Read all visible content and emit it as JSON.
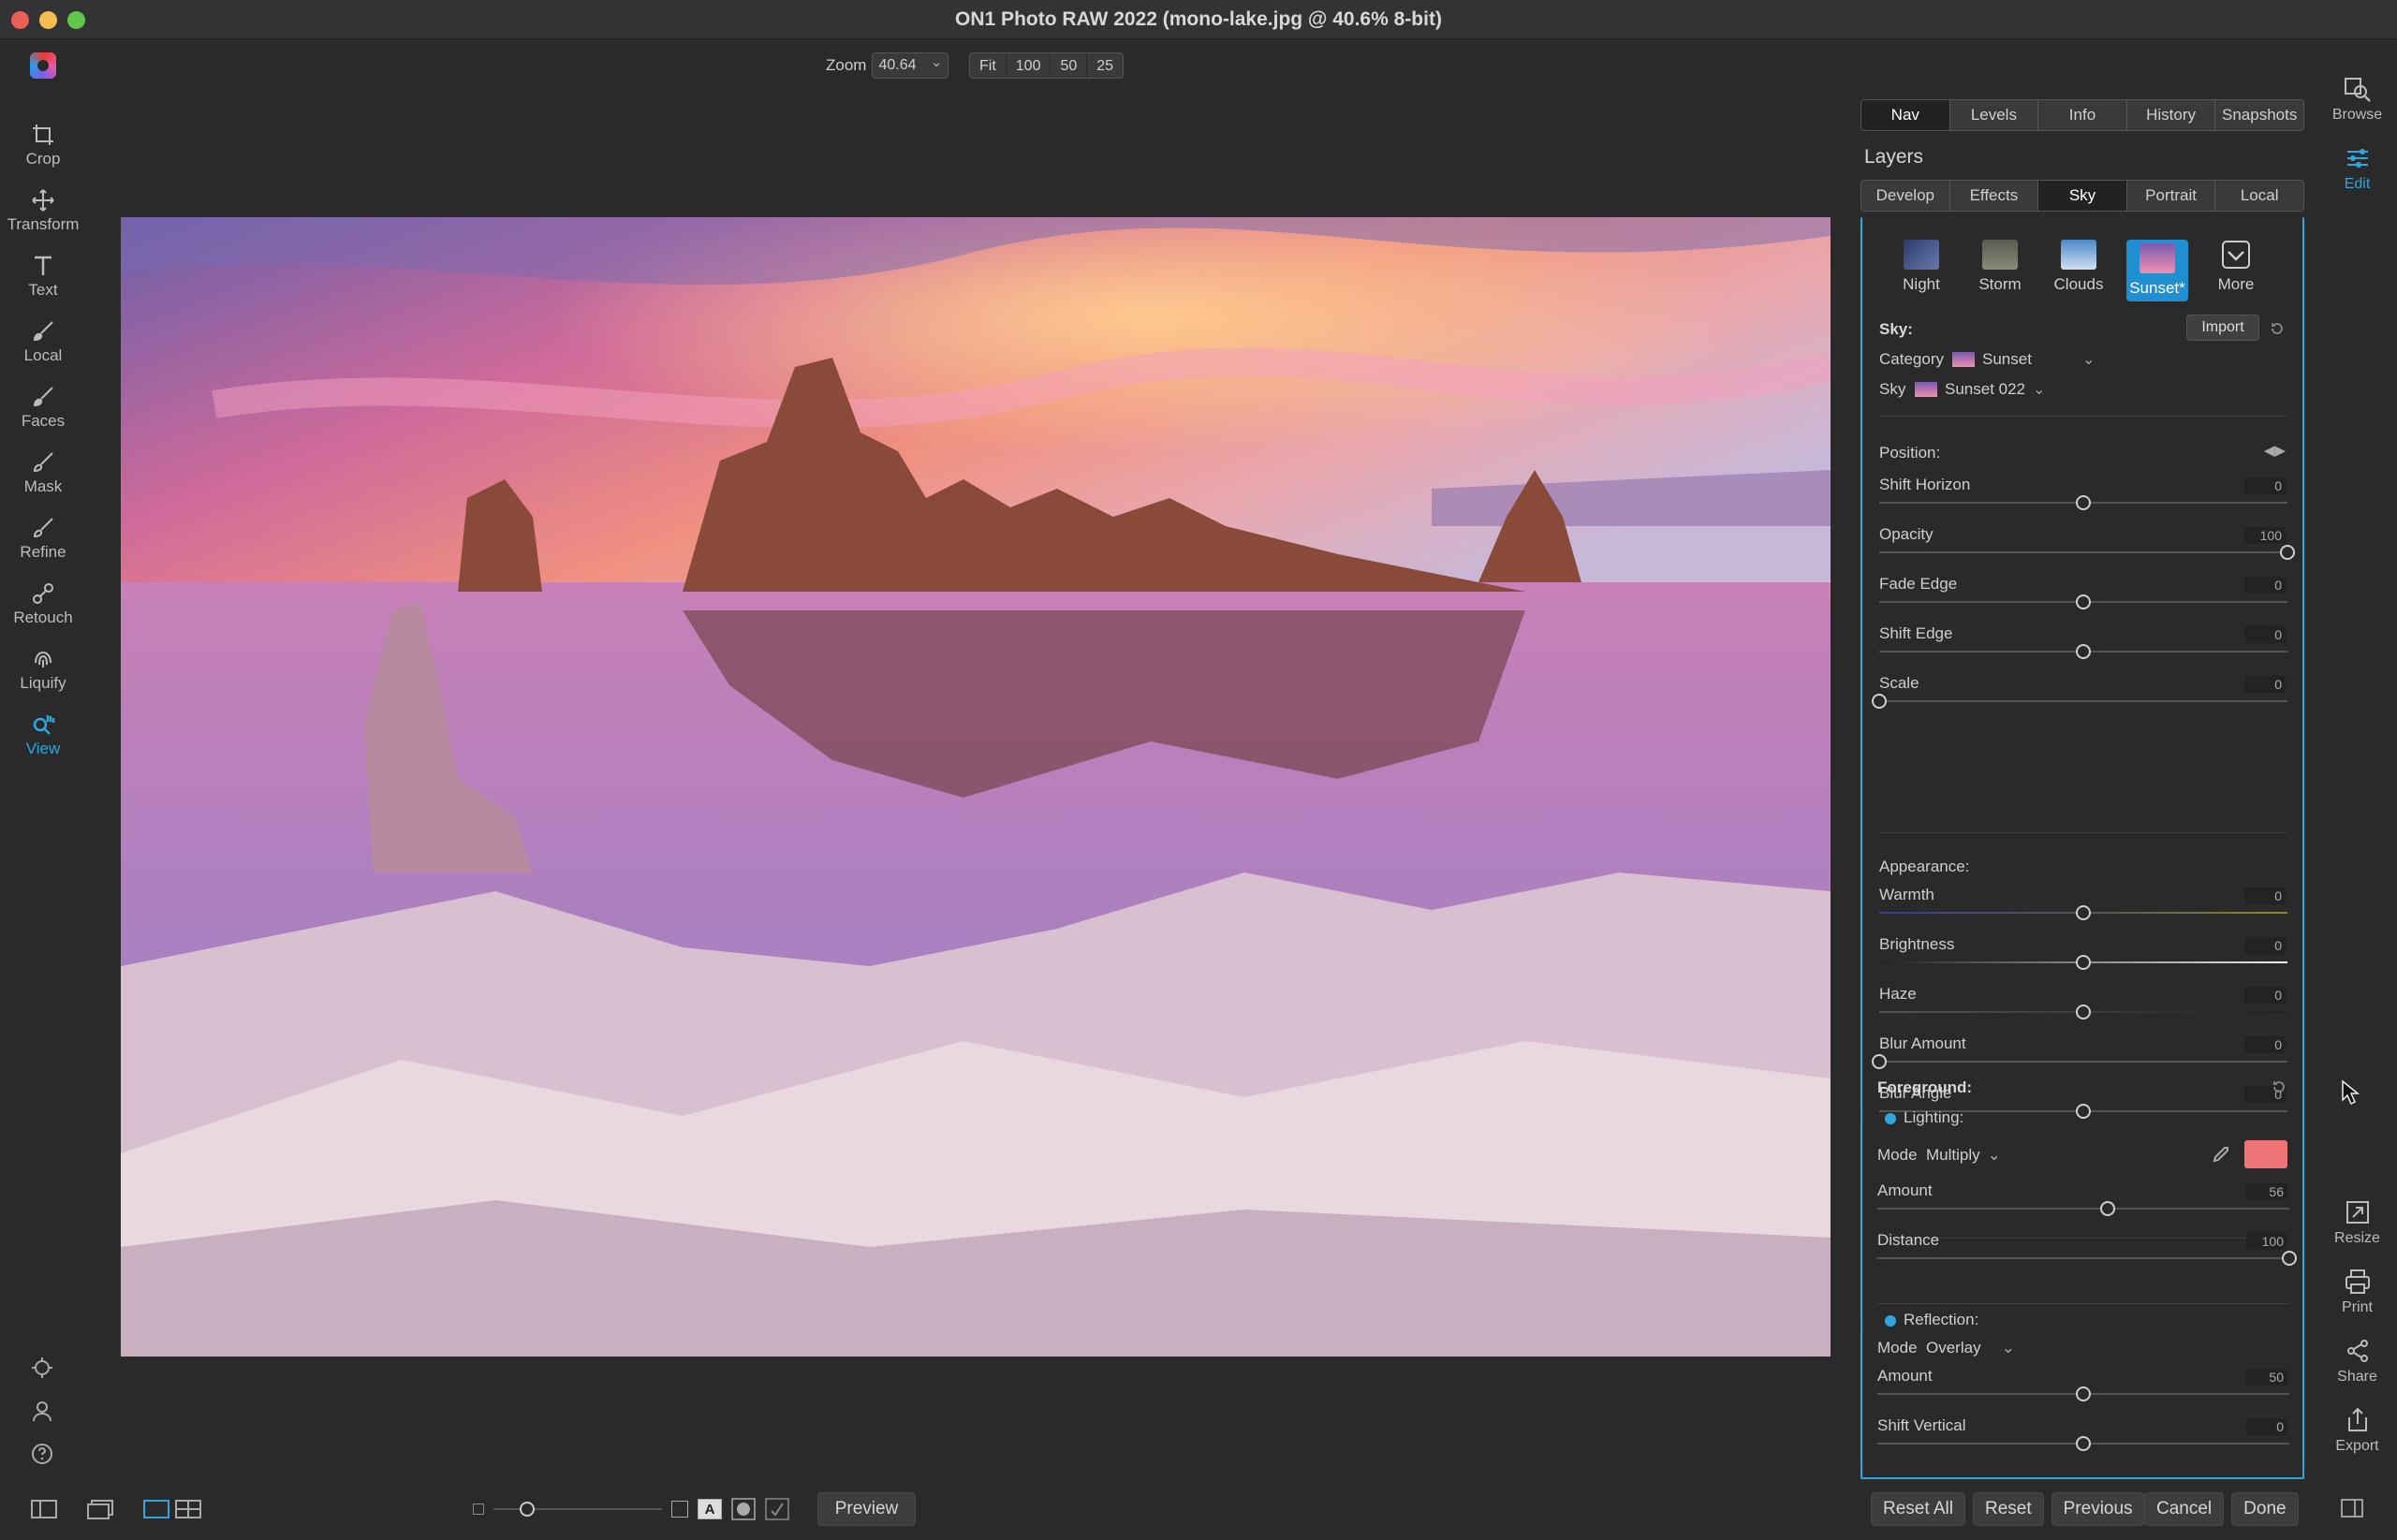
{
  "window": {
    "title": "ON1 Photo RAW 2022 (mono-lake.jpg @ 40.6% 8-bit)"
  },
  "zoom": {
    "label": "Zoom",
    "value": "40.64",
    "presets": [
      "Fit",
      "100",
      "50",
      "25"
    ]
  },
  "left_tools": [
    {
      "name": "crop",
      "label": "Crop"
    },
    {
      "name": "transform",
      "label": "Transform"
    },
    {
      "name": "text",
      "label": "Text"
    },
    {
      "name": "local",
      "label": "Local"
    },
    {
      "name": "faces",
      "label": "Faces"
    },
    {
      "name": "mask",
      "label": "Mask"
    },
    {
      "name": "refine",
      "label": "Refine"
    },
    {
      "name": "retouch",
      "label": "Retouch"
    },
    {
      "name": "liquify",
      "label": "Liquify"
    },
    {
      "name": "view",
      "label": "View",
      "active": true
    }
  ],
  "right_rail": {
    "top": [
      {
        "name": "browse",
        "label": "Browse"
      },
      {
        "name": "edit",
        "label": "Edit",
        "active": true
      }
    ],
    "bottom": [
      {
        "name": "resize",
        "label": "Resize"
      },
      {
        "name": "print",
        "label": "Print"
      },
      {
        "name": "share",
        "label": "Share"
      },
      {
        "name": "export",
        "label": "Export"
      }
    ]
  },
  "panel_tabs": [
    "Nav",
    "Levels",
    "Info",
    "History",
    "Snapshots"
  ],
  "panel_tabs_selected": "Nav",
  "layers_title": "Layers",
  "module_tabs": [
    "Develop",
    "Effects",
    "Sky",
    "Portrait",
    "Local"
  ],
  "module_tabs_selected": "Sky",
  "sky_presets": [
    {
      "label": "Night"
    },
    {
      "label": "Storm"
    },
    {
      "label": "Clouds"
    },
    {
      "label": "Sunset*",
      "selected": true
    },
    {
      "label": "More"
    }
  ],
  "sky": {
    "header": "Sky:",
    "import_label": "Import",
    "category_label": "Category",
    "category_value": "Sunset",
    "sky_label": "Sky",
    "sky_value": "Sunset 022"
  },
  "position": {
    "header": "Position:",
    "sliders": [
      {
        "label": "Shift Horizon",
        "value": "0",
        "pct": 0.5
      },
      {
        "label": "Opacity",
        "value": "100",
        "pct": 1.0
      },
      {
        "label": "Fade Edge",
        "value": "0",
        "pct": 0.5
      },
      {
        "label": "Shift Edge",
        "value": "0",
        "pct": 0.5
      },
      {
        "label": "Scale",
        "value": "0",
        "pct": 0.0
      }
    ]
  },
  "appearance": {
    "header": "Appearance:",
    "sliders": [
      {
        "label": "Warmth",
        "value": "0",
        "pct": 0.5
      },
      {
        "label": "Brightness",
        "value": "0",
        "pct": 0.5
      },
      {
        "label": "Haze",
        "value": "0",
        "pct": 0.5
      },
      {
        "label": "Blur Amount",
        "value": "0",
        "pct": 0.0
      },
      {
        "label": "Blur Angle",
        "value": "0",
        "pct": 0.5
      }
    ]
  },
  "foreground": {
    "header": "Foreground:",
    "lighting_label": "Lighting:",
    "mode_label": "Mode",
    "mode_value": "Multiply",
    "color": "#f07477",
    "sliders": [
      {
        "label": "Amount",
        "value": "56",
        "pct": 0.56
      },
      {
        "label": "Distance",
        "value": "100",
        "pct": 1.0
      }
    ],
    "reflection_label": "Reflection:",
    "reflection_mode_label": "Mode",
    "reflection_mode_value": "Overlay",
    "reflection_sliders": [
      {
        "label": "Amount",
        "value": "50",
        "pct": 0.5
      },
      {
        "label": "Shift Vertical",
        "value": "0",
        "pct": 0.5
      }
    ]
  },
  "bottom": {
    "preview": "Preview",
    "buttons": [
      "Reset All",
      "Reset",
      "Previous",
      "Cancel",
      "Done"
    ]
  },
  "accent": "#2ea7e0"
}
